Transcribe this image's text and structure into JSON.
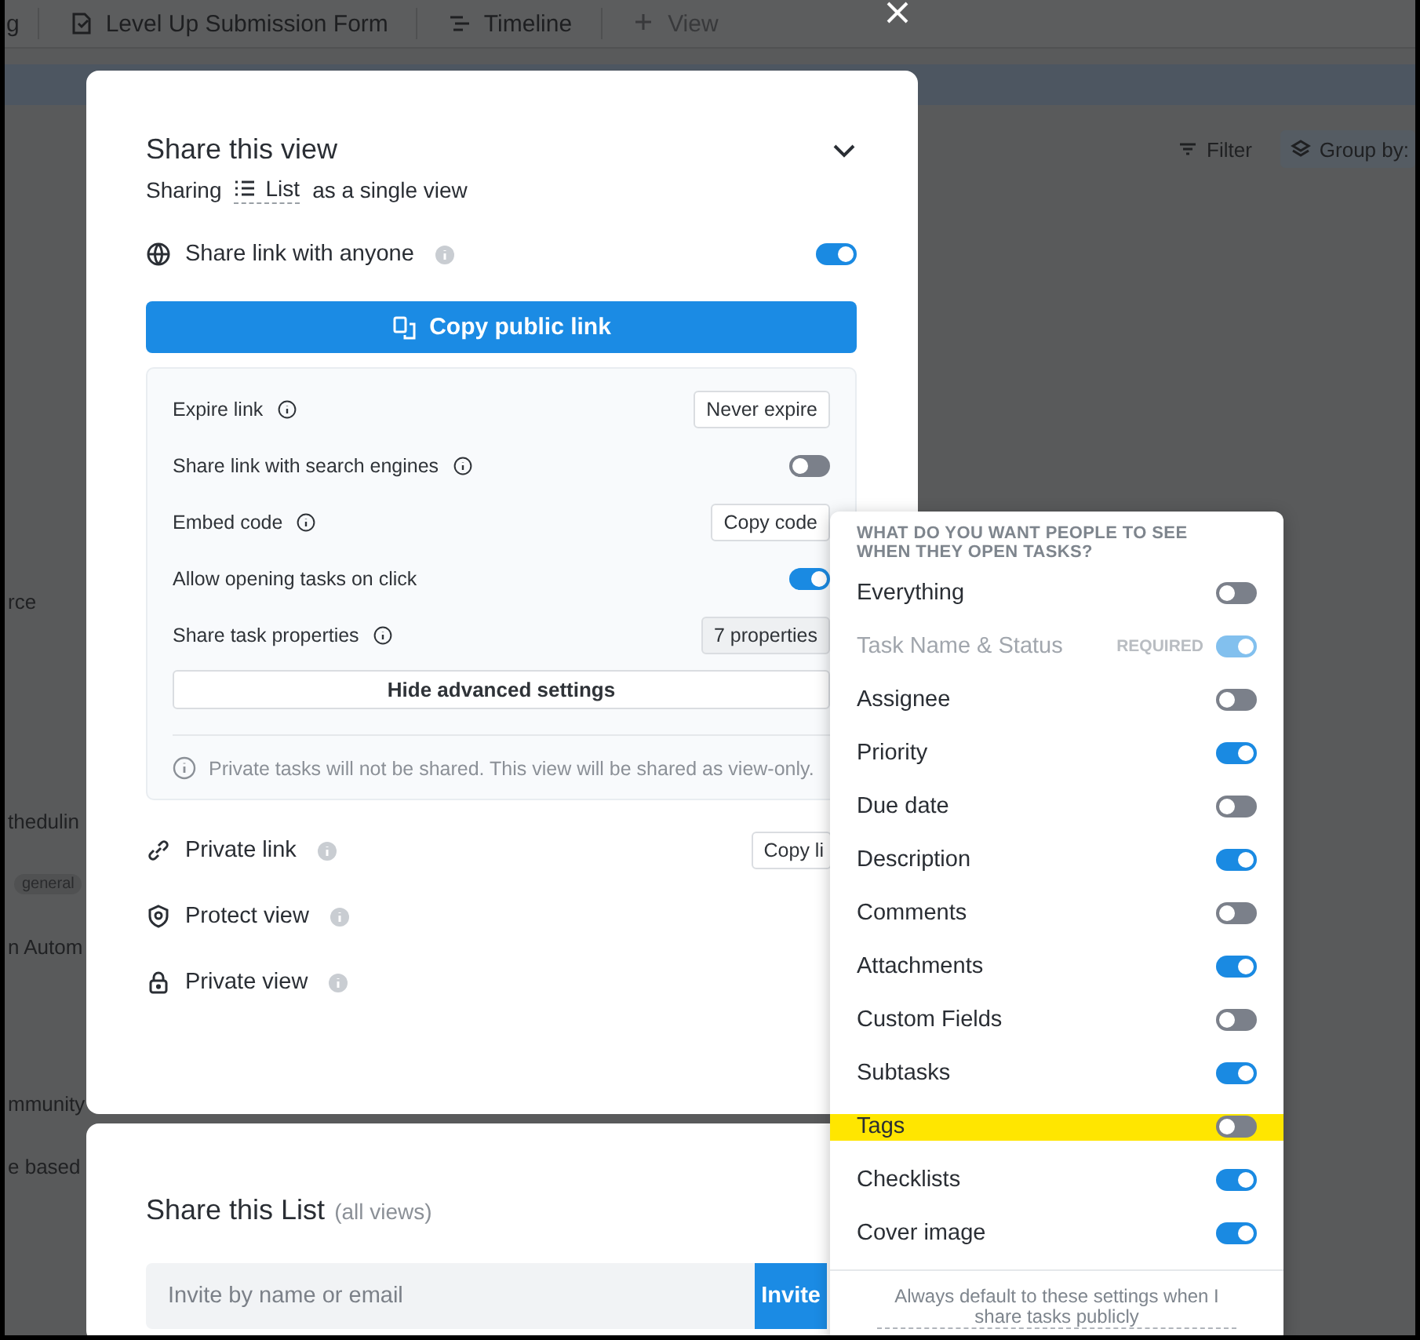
{
  "background": {
    "tabs": [
      {
        "kind": "text",
        "label": "g"
      },
      {
        "kind": "form",
        "label": "Level Up Submission Form"
      },
      {
        "kind": "timeline",
        "label": "Timeline"
      },
      {
        "kind": "add",
        "label": "View"
      }
    ],
    "toolbar": [
      {
        "kind": "filter",
        "label": "Filter"
      },
      {
        "kind": "group",
        "label": "Group by:"
      }
    ],
    "fragments": [
      {
        "kind": "text",
        "label": "rce"
      },
      {
        "kind": "text",
        "label": "thedulin"
      },
      {
        "kind": "tag",
        "label": "general"
      },
      {
        "kind": "text",
        "label": "n Autom"
      },
      {
        "kind": "text",
        "label": "mmunity"
      },
      {
        "kind": "text",
        "label": "e based"
      }
    ]
  },
  "share_view": {
    "title": "Share this view",
    "sharing": {
      "prefix": "Sharing",
      "view": "List",
      "suffix": "as a single view"
    },
    "public_link": {
      "label": "Share link with anyone",
      "on": true
    },
    "copy_button": "Copy public link",
    "advanced": [
      {
        "kind": "button",
        "label": "Expire link",
        "info": true,
        "value": "Never expire"
      },
      {
        "kind": "toggle",
        "label": "Share link with search engines",
        "info": true,
        "on": false
      },
      {
        "kind": "button",
        "label": "Embed code",
        "info": true,
        "value": "Copy code"
      },
      {
        "kind": "toggle",
        "label": "Allow opening tasks on click",
        "info": false,
        "on": true
      },
      {
        "kind": "button",
        "label": "Share task properties",
        "info": true,
        "value": "7 properties",
        "active": true
      }
    ],
    "hide_button": "Hide advanced settings",
    "note": "Private tasks will not be shared. This view will be shared as view-only.",
    "options": [
      {
        "kind": "link",
        "label": "Private link",
        "button": "Copy li"
      },
      {
        "kind": "shield",
        "label": "Protect view"
      },
      {
        "kind": "lock",
        "label": "Private view"
      }
    ]
  },
  "share_list": {
    "title": "Share this List",
    "subtitle": "(all views)",
    "invite": {
      "placeholder": "Invite by name or email"
    },
    "invite_button": "Invite"
  },
  "properties": {
    "heading": "WHAT DO YOU WANT PEOPLE TO SEE WHEN THEY OPEN TASKS?",
    "items": [
      {
        "label": "Everything",
        "on": false,
        "disabled": false,
        "highlighted": false
      },
      {
        "label": "Task Name & Status",
        "on": true,
        "disabled": true,
        "badge": "REQUIRED",
        "highlighted": false
      },
      {
        "label": "Assignee",
        "on": false,
        "disabled": false,
        "highlighted": false
      },
      {
        "label": "Priority",
        "on": true,
        "disabled": false,
        "highlighted": false
      },
      {
        "label": "Due date",
        "on": false,
        "disabled": false,
        "highlighted": false
      },
      {
        "label": "Description",
        "on": true,
        "disabled": false,
        "highlighted": false
      },
      {
        "label": "Comments",
        "on": false,
        "disabled": false,
        "highlighted": false
      },
      {
        "label": "Attachments",
        "on": true,
        "disabled": false,
        "highlighted": false
      },
      {
        "label": "Custom Fields",
        "on": false,
        "disabled": false,
        "highlighted": false
      },
      {
        "label": "Subtasks",
        "on": true,
        "disabled": false,
        "highlighted": false
      },
      {
        "label": "Tags",
        "on": false,
        "disabled": false,
        "highlighted": true
      },
      {
        "label": "Checklists",
        "on": true,
        "disabled": false,
        "highlighted": false
      },
      {
        "label": "Cover image",
        "on": true,
        "disabled": false,
        "highlighted": false
      }
    ],
    "footer_link": "Always default to these settings when I share tasks publicly"
  }
}
